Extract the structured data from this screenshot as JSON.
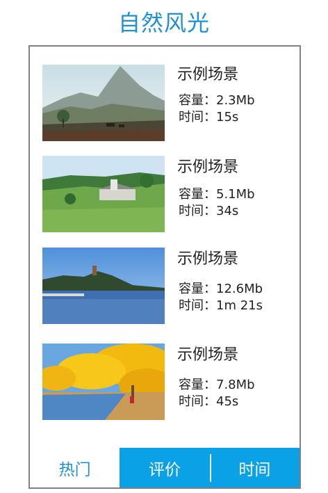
{
  "header": {
    "title": "自然风光"
  },
  "items": [
    {
      "name": "示例场景",
      "size": "容量：2.3Mb",
      "time": "时间：15s",
      "image": "countryside-mountain-photo"
    },
    {
      "name": "示例场景",
      "size": "容量：5.1Mb",
      "time": "时间：34s",
      "image": "green-meadow-house-photo"
    },
    {
      "name": "示例场景",
      "size": "容量：12.6Mb",
      "time": "时间：1m 21s",
      "image": "lake-pagoda-photo"
    },
    {
      "name": "示例场景",
      "size": "容量：7.8Mb",
      "time": "时间：45s",
      "image": "golden-trees-river-photo"
    }
  ],
  "tabs": [
    {
      "label": "热门",
      "state": "active"
    },
    {
      "label": "评价",
      "state": "inactive"
    },
    {
      "label": "时间",
      "state": "inactive"
    }
  ],
  "colors": {
    "accent": "#1e90d6",
    "tab_bar": "#0ba1e6",
    "border": "#808080"
  }
}
